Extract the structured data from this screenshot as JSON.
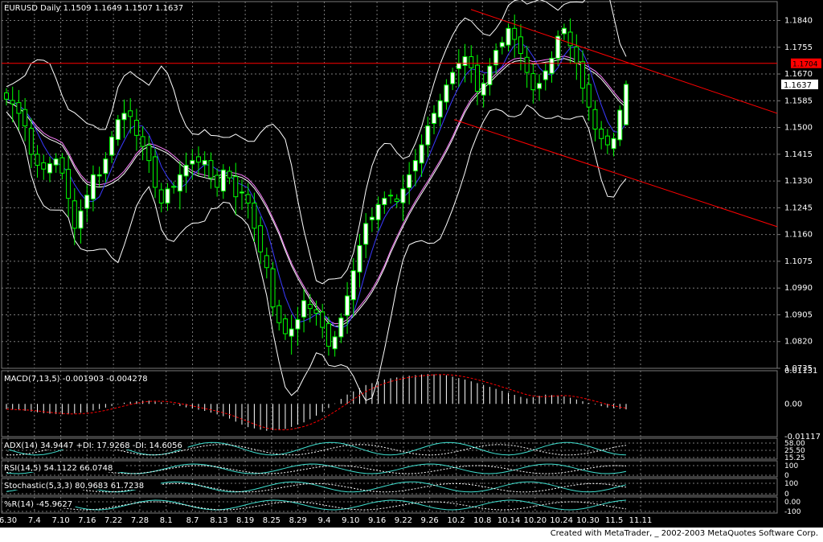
{
  "footer": {
    "credit": "Created with MetaTrader, _ 2002-2003 MetaQuotes Software Corp."
  },
  "colors": {
    "background": "#000000",
    "grid": "#7a7a7a",
    "bull_candle": "#ffffff",
    "bear_candle": "#000000",
    "candle_outline": "#00ff00",
    "bands": "#ffffff",
    "ma_fast": "#3a3aff",
    "ma_slow_1": "#ff80ff",
    "ma_slow_2": "#ffffff",
    "trend_channel": "#ff0000",
    "macd_hist": "#ffffff",
    "macd_signal": "#ff0000",
    "ind_line_1": "#40e0d0",
    "ind_line_2": "#ffffff",
    "scale_text": "#ffffff",
    "current_price_box": "#ffffff",
    "resistance_box": "#ff0000"
  },
  "chart_data": [
    {
      "type": "candlestick",
      "title": "EURUSD Daily  1.1509 1.1649 1.1507 1.1637",
      "symbol": "EURUSD",
      "timeframe": "Daily",
      "last_ohlc": {
        "open": 1.1509,
        "high": 1.1649,
        "low": 1.1507,
        "close": 1.1637
      },
      "y_ticks": [
        "1.1840",
        "1.1755",
        "1.1670",
        "1.1585",
        "1.1500",
        "1.1415",
        "1.1330",
        "1.1245",
        "1.1160",
        "1.1075",
        "1.0990",
        "1.0905",
        "1.0820",
        "1.0735"
      ],
      "ylim": [
        1.0735,
        1.19
      ],
      "current_price_label": "1.1637",
      "horizontal_line": {
        "value": 1.1704,
        "label": "1.1704"
      },
      "x_ticks": [
        "6.30",
        "7.4",
        "7.10",
        "7.16",
        "7.22",
        "7.28",
        "8.1",
        "8.7",
        "8.13",
        "8.19",
        "8.25",
        "8.29",
        "9.4",
        "9.10",
        "9.16",
        "9.22",
        "9.26",
        "10.2",
        "10.8",
        "10.14",
        "10.20",
        "10.24",
        "10.30",
        "11.5",
        "11.11"
      ],
      "grid": true,
      "closes": [
        1.159,
        1.1575,
        1.1545,
        1.1505,
        1.1415,
        1.138,
        1.1368,
        1.1385,
        1.14,
        1.1355,
        1.1275,
        1.118,
        1.1235,
        1.1285,
        1.135,
        1.135,
        1.14,
        1.147,
        1.1525,
        1.1545,
        1.1535,
        1.1475,
        1.144,
        1.1395,
        1.131,
        1.126,
        1.1305,
        1.131,
        1.135,
        1.138,
        1.1395,
        1.139,
        1.1395,
        1.134,
        1.131,
        1.1365,
        1.134,
        1.128,
        1.1295,
        1.126,
        1.118,
        1.1105,
        1.1055,
        1.093,
        1.088,
        1.0845,
        1.086,
        1.089,
        1.095,
        1.0925,
        1.091,
        1.0865,
        1.0805,
        1.0835,
        1.0895,
        1.0965,
        1.1045,
        1.1125,
        1.1195,
        1.1215,
        1.1255,
        1.1275,
        1.1285,
        1.1265,
        1.1305,
        1.135,
        1.1395,
        1.1445,
        1.1505,
        1.1545,
        1.1585,
        1.1635,
        1.1675,
        1.1705,
        1.1725,
        1.169,
        1.1615,
        1.164,
        1.1695,
        1.1745,
        1.177,
        1.1815,
        1.178,
        1.1735,
        1.1675,
        1.162,
        1.164,
        1.168,
        1.172,
        1.179,
        1.1815,
        1.176,
        1.1705,
        1.1625,
        1.1565,
        1.1495,
        1.1465,
        1.1445,
        1.1465,
        1.1555,
        1.1637
      ]
    },
    {
      "type": "line",
      "title": "MACD(7,13,5)  -0.001903  -0.004278",
      "y_ticks": [
        "0.01131",
        "0.00",
        "-0.01117"
      ],
      "ylim": [
        -0.01117,
        0.01131
      ],
      "hist_sample": [
        -0.0018,
        -0.0024,
        -0.0033,
        -0.0036,
        -0.0028,
        -0.0012,
        0.0006,
        0.0012,
        0.0003,
        -0.0012,
        -0.0025,
        -0.0045,
        -0.0078,
        -0.0092,
        -0.0085,
        -0.006,
        -0.002,
        0.003,
        0.0065,
        0.0085,
        0.0095,
        0.0102,
        0.0098,
        0.0082,
        0.0062,
        0.004,
        0.0018,
        0.0032,
        0.0025,
        0.0006,
        -0.0012,
        -0.0019
      ]
    },
    {
      "type": "line",
      "title": "ADX(14) 34.9447 +DI: 17.9268 -DI: 14.6056",
      "y_ticks": [
        "58.00",
        "25.50",
        "15.25"
      ]
    },
    {
      "type": "line",
      "title": "RSI(14,5)  54.1122  66.0748",
      "y_ticks": [
        "100",
        "0"
      ]
    },
    {
      "type": "line",
      "title": "Stochastic(5,3,3)  80.9683  61.7238",
      "y_ticks": [
        "100",
        "0"
      ]
    },
    {
      "type": "line",
      "title": "%R(14)  -45.9627",
      "y_ticks": [
        "0.00",
        "-100"
      ]
    }
  ]
}
